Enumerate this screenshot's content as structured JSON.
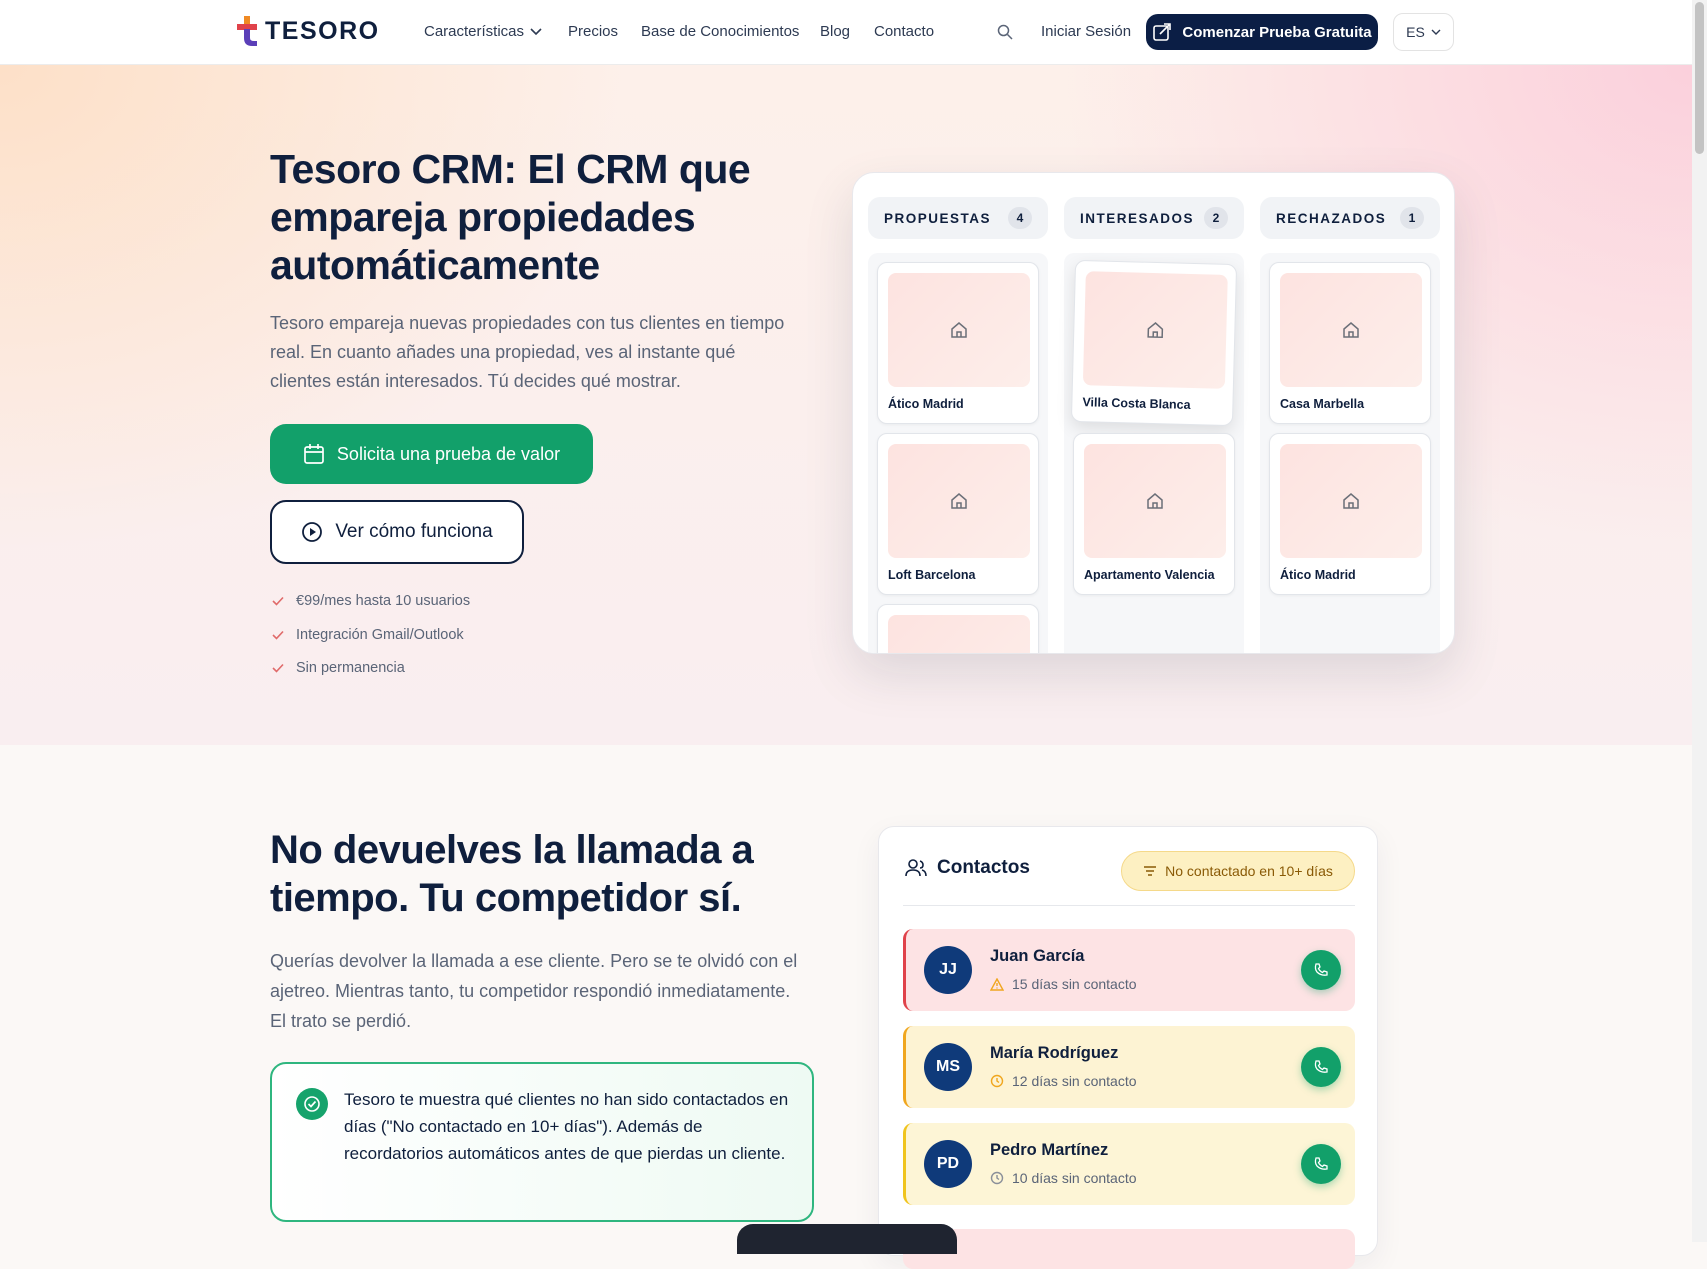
{
  "nav": {
    "brand": "TESORO",
    "items": [
      "Características",
      "Precios",
      "Base de Conocimientos",
      "Blog",
      "Contacto"
    ],
    "login": "Iniciar Sesión",
    "cta": "Comenzar Prueba Gratuita",
    "lang": "ES"
  },
  "hero": {
    "title": "Tesoro CRM: El CRM que empareja propiedades automáticamente",
    "desc": "Tesoro empareja nuevas propiedades con tus clientes en tiempo real. En cuanto añades una propiedad, ves al instante qué clientes están interesados. Tú decides qué mostrar.",
    "primary_cta": "Solicita una prueba de valor",
    "secondary_cta": "Ver cómo funciona",
    "benefits": [
      "€99/mes hasta 10 usuarios",
      "Integración Gmail/Outlook",
      "Sin permanencia"
    ]
  },
  "kanban": {
    "columns": [
      {
        "title": "PROPUESTAS",
        "count": "4",
        "cards": [
          "Ático Madrid",
          "Loft Barcelona"
        ]
      },
      {
        "title": "INTERESADOS",
        "count": "2",
        "cards": [
          "Villa Costa Blanca",
          "Apartamento Valencia"
        ]
      },
      {
        "title": "RECHAZADOS",
        "count": "1",
        "cards": [
          "Casa Marbella",
          "Ático Madrid"
        ]
      }
    ]
  },
  "section2": {
    "title": "No devuelves la llamada a tiempo. Tu competidor sí.",
    "desc": "Querías devolver la llamada a ese cliente. Pero se te olvidó con el ajetreo. Mientras tanto, tu competidor respondió inmediatamente. El trato se perdió.",
    "callout": "Tesoro te muestra qué clientes no han sido contactados en días (\"No contactado en 10+ días\"). Además de recordatorios automáticos antes de que pierdas un cliente."
  },
  "contacts": {
    "title": "Contactos",
    "filter": "No contactado en 10+ días",
    "rows": [
      {
        "initials": "JJ",
        "name": "Juan García",
        "status": "15 días sin contacto"
      },
      {
        "initials": "MS",
        "name": "María Rodríguez",
        "status": "12 días sin contacto"
      },
      {
        "initials": "PD",
        "name": "Pedro Martínez",
        "status": "10 días sin contacto"
      }
    ]
  },
  "colors": {
    "primary": "#0b1e45",
    "accent": "#12a06a",
    "warning": "#f0a61e",
    "danger": "#e0424a"
  }
}
